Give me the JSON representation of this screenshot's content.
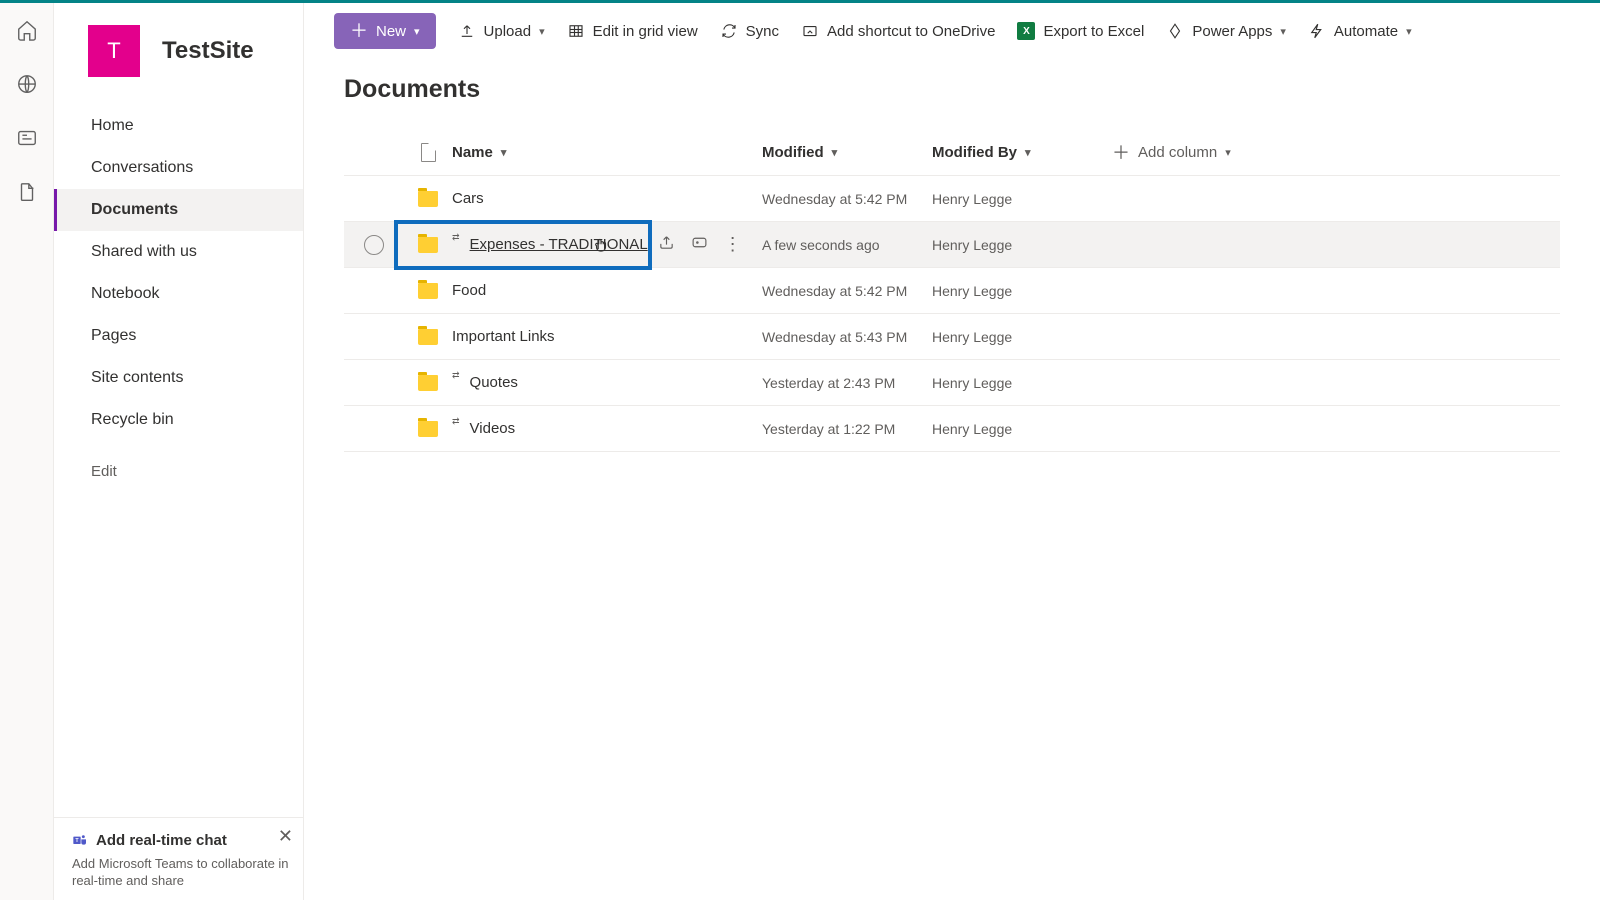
{
  "site": {
    "logo_letter": "T",
    "title": "TestSite"
  },
  "nav": {
    "items": [
      {
        "label": "Home"
      },
      {
        "label": "Conversations"
      },
      {
        "label": "Documents",
        "active": true
      },
      {
        "label": "Shared with us"
      },
      {
        "label": "Notebook"
      },
      {
        "label": "Pages"
      },
      {
        "label": "Site contents"
      },
      {
        "label": "Recycle bin"
      }
    ],
    "edit": "Edit"
  },
  "chat_card": {
    "title": "Add real-time chat",
    "desc": "Add Microsoft Teams to collaborate in real-time and share"
  },
  "cmdbar": {
    "new": "New",
    "upload": "Upload",
    "edit_grid": "Edit in grid view",
    "sync": "Sync",
    "onedrive": "Add shortcut to OneDrive",
    "export": "Export to Excel",
    "powerapps": "Power Apps",
    "automate": "Automate"
  },
  "page": {
    "title": "Documents"
  },
  "columns": {
    "name": "Name",
    "modified": "Modified",
    "modified_by": "Modified By",
    "add": "Add column"
  },
  "rows": [
    {
      "name": "Cars",
      "modified": "Wednesday at 5:42 PM",
      "modified_by": "Henry Legge",
      "link": false
    },
    {
      "name": "Expenses - TRADITIONAL",
      "modified": "A few seconds ago",
      "modified_by": "Henry Legge",
      "link": true,
      "hovered": true,
      "highlighted": true
    },
    {
      "name": "Food",
      "modified": "Wednesday at 5:42 PM",
      "modified_by": "Henry Legge",
      "link": false
    },
    {
      "name": "Important Links",
      "modified": "Wednesday at 5:43 PM",
      "modified_by": "Henry Legge",
      "link": false
    },
    {
      "name": "Quotes",
      "modified": "Yesterday at 2:43 PM",
      "modified_by": "Henry Legge",
      "link": true
    },
    {
      "name": "Videos",
      "modified": "Yesterday at 1:22 PM",
      "modified_by": "Henry Legge",
      "link": true
    }
  ]
}
